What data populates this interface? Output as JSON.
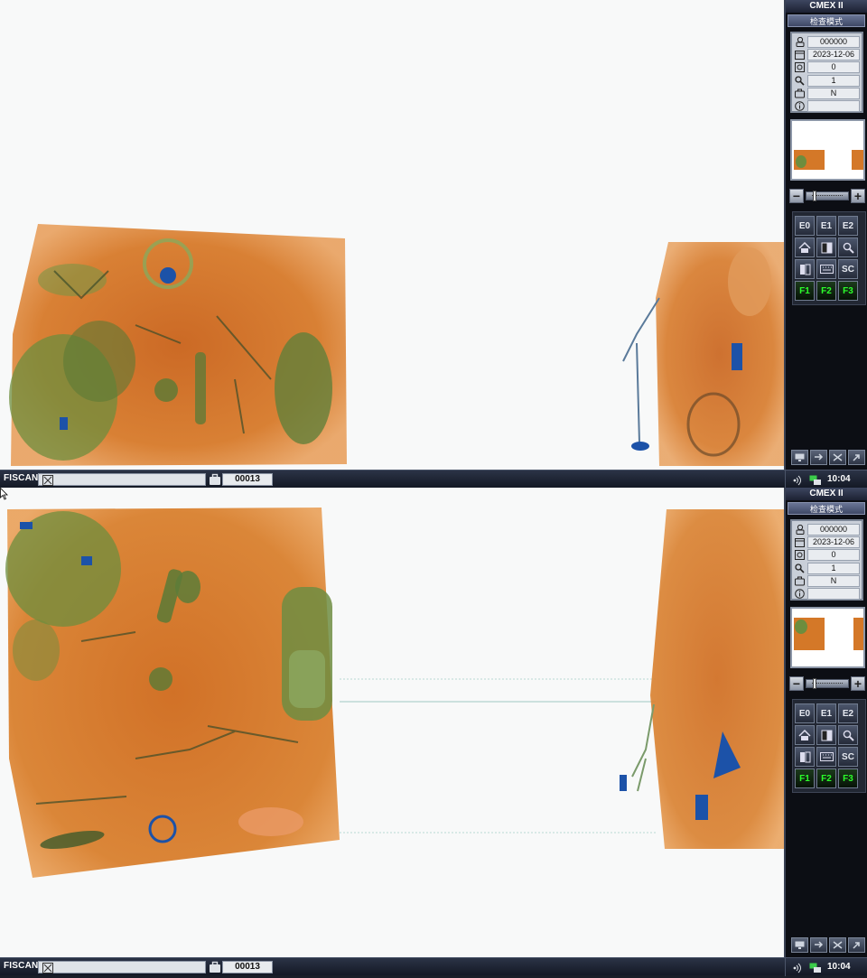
{
  "screens": [
    {
      "taskbar": {
        "brand": "FISCAN",
        "search_value": "",
        "bag_count": "00013",
        "clock": "10:04"
      },
      "panel": {
        "title": "CMEX II",
        "mode": "检查模式",
        "info": [
          {
            "icon": "operator-icon",
            "value": "000000"
          },
          {
            "icon": "calendar-icon",
            "value": "2023-12-06"
          },
          {
            "icon": "counter-icon",
            "value": "0"
          },
          {
            "icon": "magnifier-icon",
            "value": "1"
          },
          {
            "icon": "suitcase-icon",
            "value": "N"
          },
          {
            "icon": "info-icon",
            "value": ""
          }
        ],
        "zoom_level": 0.1,
        "buttons": [
          "E0",
          "E1",
          "E2",
          "home-icon",
          "contrast-icon",
          "magnify-icon",
          "split-icon",
          "keyboard-icon",
          "SC",
          "F1",
          "F2",
          "F3"
        ]
      }
    },
    {
      "taskbar": {
        "brand": "FISCAN",
        "search_value": "",
        "bag_count": "00013",
        "clock": "10:04"
      },
      "panel": {
        "title": "CMEX II",
        "mode": "检查模式",
        "info": [
          {
            "icon": "operator-icon",
            "value": "000000"
          },
          {
            "icon": "calendar-icon",
            "value": "2023-12-06"
          },
          {
            "icon": "counter-icon",
            "value": "0"
          },
          {
            "icon": "magnifier-icon",
            "value": "1"
          },
          {
            "icon": "suitcase-icon",
            "value": "N"
          },
          {
            "icon": "info-icon",
            "value": ""
          }
        ],
        "zoom_level": 0.1,
        "buttons": [
          "E0",
          "E1",
          "E2",
          "home-icon",
          "contrast-icon",
          "magnify-icon",
          "split-icon",
          "keyboard-icon",
          "SC",
          "F1",
          "F2",
          "F3"
        ]
      }
    }
  ],
  "colors": {
    "orange": "#d2721e",
    "green": "#5f8a3c",
    "blue": "#1c52a8",
    "accent_green": "#2bff2b"
  }
}
